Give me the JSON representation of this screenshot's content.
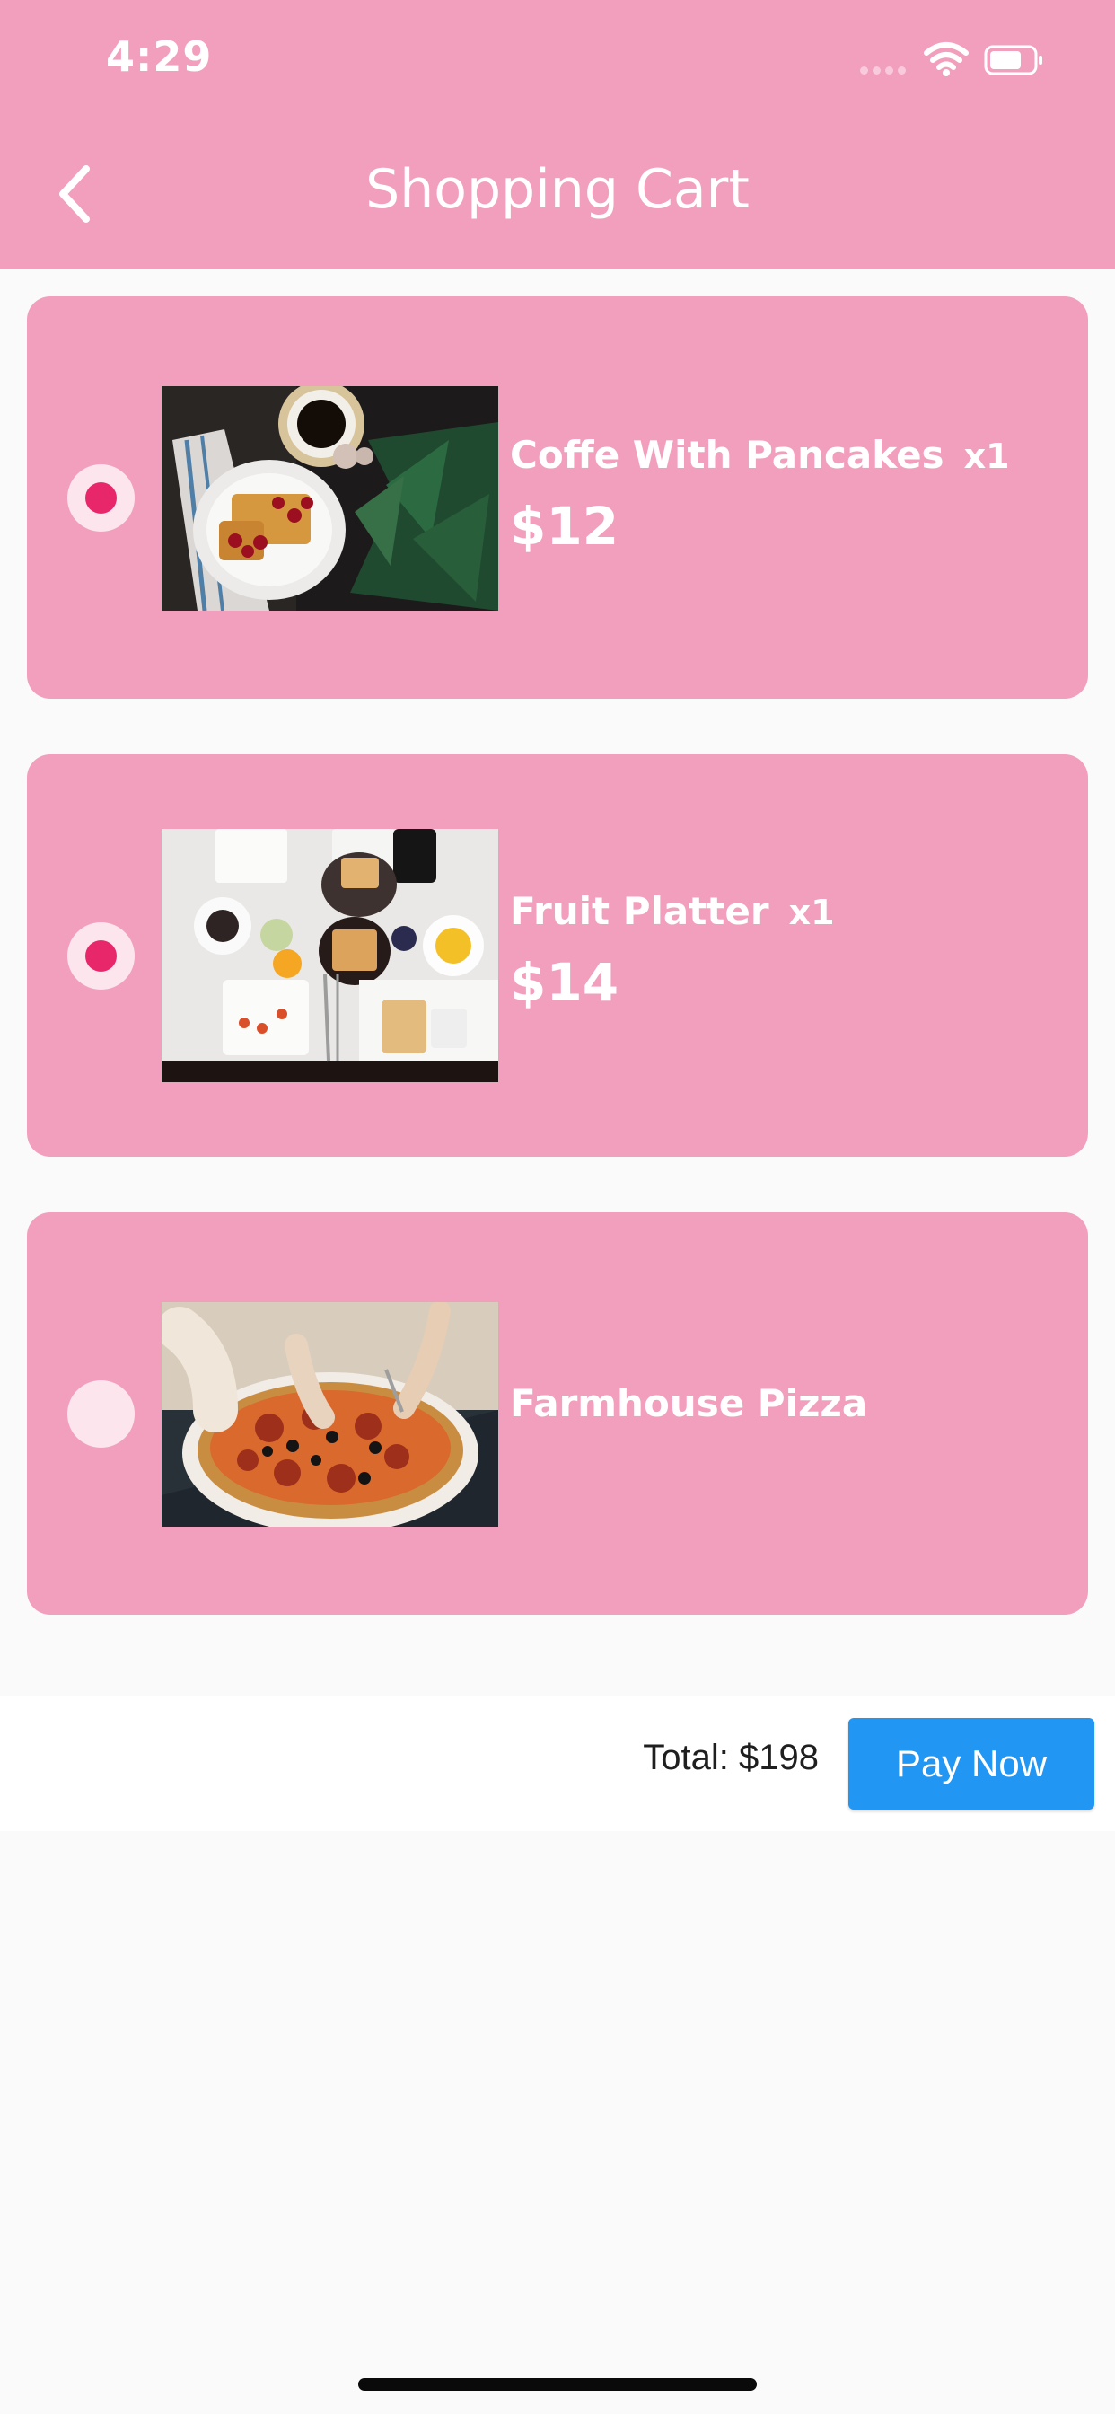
{
  "theme": {
    "accent": "#f29fbd",
    "radio_bg": "#fde5ee",
    "radio_dot": "#e7276a",
    "pay_button": "#2196f3"
  },
  "status_bar": {
    "time": "4:29",
    "icons": [
      "signal-icon",
      "wifi-icon",
      "battery-icon"
    ]
  },
  "header": {
    "back_icon": "chevron-left-icon",
    "title": "Shopping Cart"
  },
  "cart": {
    "items": [
      {
        "name": "Coffe With Pancakes",
        "quantity": "x1",
        "price": "$12",
        "selected": true,
        "image": "coffee-with-pancakes-photo"
      },
      {
        "name": "Fruit Platter",
        "quantity": "x1",
        "price": "$14",
        "selected": true,
        "image": "fruit-platter-photo"
      },
      {
        "name": "Farmhouse Pizza",
        "quantity": "",
        "price": "",
        "selected": false,
        "image": "farmhouse-pizza-photo"
      }
    ]
  },
  "footer": {
    "total": "Total: $198",
    "pay_label": "Pay Now"
  }
}
